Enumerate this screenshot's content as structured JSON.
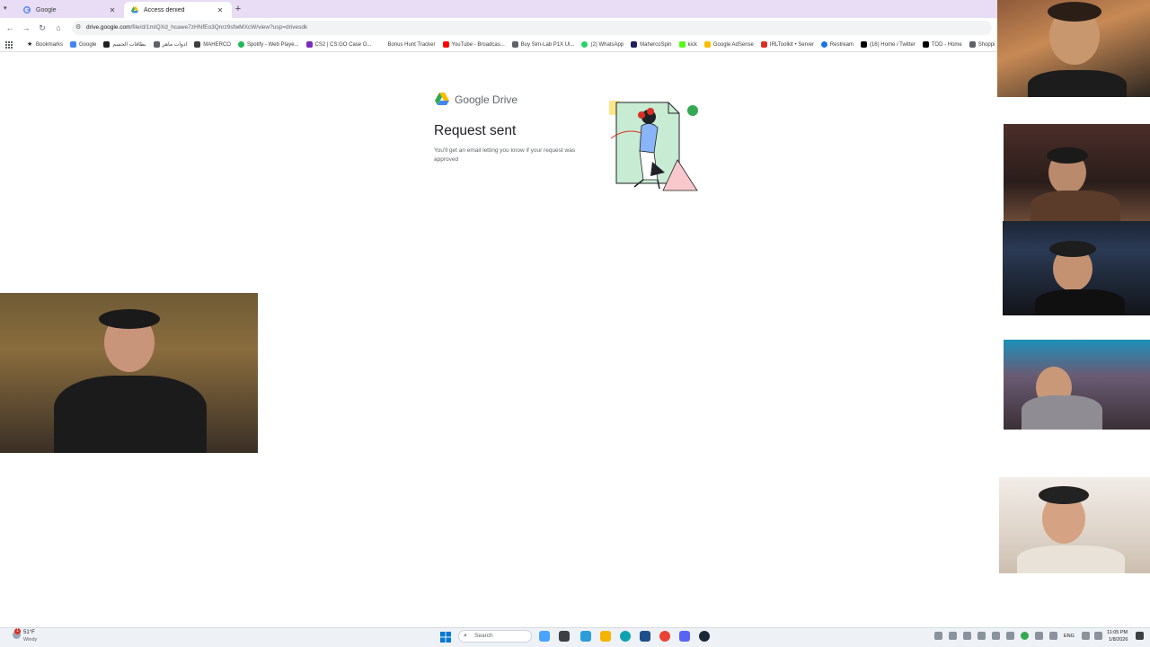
{
  "browser": {
    "tabs": [
      {
        "title": "Google",
        "icon": "google-g-icon"
      },
      {
        "title": "Access denied",
        "icon": "drive-icon"
      }
    ],
    "url_host": "drive.google.com",
    "url_path": "/file/d/1mIQXd_hcawe7zHNfEo3Qnrz9sfwMXcW/view?usp=drivesdk",
    "bookmarks": [
      {
        "label": "Bookmarks",
        "color": "#202124"
      },
      {
        "label": "Google",
        "color": "#4285f4"
      },
      {
        "label": "بطاقات الحسم",
        "color": "#202124"
      },
      {
        "label": "ادوات ماهر",
        "color": "#5f6368"
      },
      {
        "label": "MAHERCO",
        "color": "#3c4043"
      },
      {
        "label": "Spotify - Web Playe...",
        "color": "#1db954"
      },
      {
        "label": "CS2 | CS:GO Case O...",
        "color": "#7b2cbf"
      },
      {
        "label": "Bonus Hunt Tracker",
        "color": "#ffffff"
      },
      {
        "label": "YouTube - Broadcas...",
        "color": "#ff0000"
      },
      {
        "label": "Buy Sim-Lab P1X Ul...",
        "color": "#5f6368"
      },
      {
        "label": "(2) WhatsApp",
        "color": "#25d366"
      },
      {
        "label": "MahercoSpin",
        "color": "#1f1f5a"
      },
      {
        "label": "kick",
        "color": "#53fc18"
      },
      {
        "label": "Google AdSense",
        "color": "#fbbc04"
      },
      {
        "label": "IRLToolkit • Server",
        "color": "#d93025"
      },
      {
        "label": "Restream",
        "color": "#1a73e8"
      },
      {
        "label": "(16) Home / Twitter",
        "color": "#000000"
      },
      {
        "label": "TOD - Home",
        "color": "#000000"
      },
      {
        "label": "Shoppi",
        "color": "#5f6368"
      }
    ]
  },
  "page": {
    "brand": "Google Drive",
    "title": "Request sent",
    "body": "You'll get an email letting you know if your request was approved"
  },
  "taskbar": {
    "weather_temp": "51°F",
    "weather_desc": "Windy",
    "weather_badge": "1",
    "search_placeholder": "Search",
    "language": "ENG",
    "time": "11:05 PM",
    "date": "1/8/2026"
  },
  "colors": {
    "tabstrip": "#e9dcf5",
    "drive_green": "#34a853",
    "drive_yellow": "#fbbc04",
    "drive_blue": "#4285f4"
  }
}
